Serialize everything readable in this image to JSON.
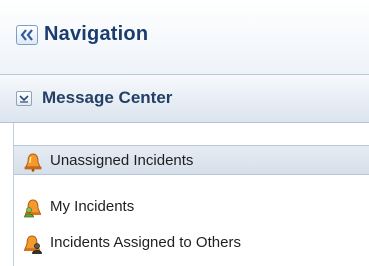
{
  "navigation": {
    "title": "Navigation"
  },
  "message_center": {
    "title": "Message Center",
    "items": [
      {
        "label": "Unassigned Incidents",
        "icon": "alarm-bell-icon",
        "selected": true
      },
      {
        "label": "My Incidents",
        "icon": "user-bell-icon",
        "selected": false
      },
      {
        "label": "Incidents Assigned to Others",
        "icon": "others-bell-icon",
        "selected": false
      }
    ]
  },
  "colors": {
    "title": "#1a3d6e",
    "bell": "#f08a1c",
    "selected_row": "#dde5ef"
  }
}
